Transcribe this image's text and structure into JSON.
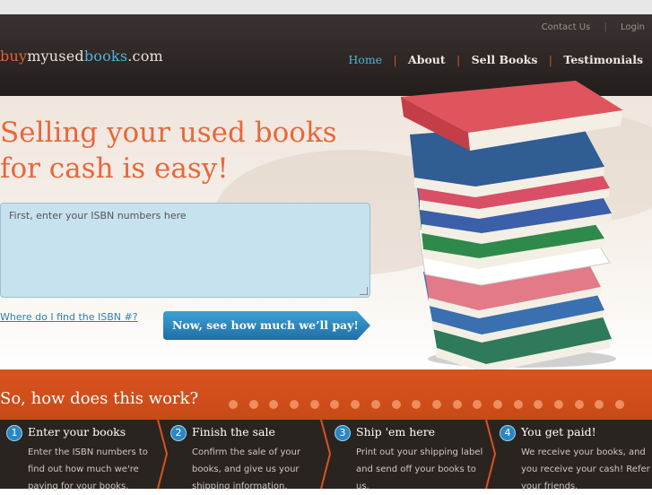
{
  "header": {
    "top_links": {
      "contact": "Contact Us",
      "separator": "|",
      "login": "Login"
    },
    "logo": {
      "part1": "buy",
      "part2": "myused",
      "part3": "books",
      "part4": ".com"
    },
    "nav": [
      {
        "label": "Home",
        "active": true
      },
      {
        "label": "About"
      },
      {
        "label": "Sell Books"
      },
      {
        "label": "Testimonials"
      }
    ],
    "nav_separator": "|"
  },
  "hero": {
    "headline_line1": "Selling your used books",
    "headline_line2": "for cash is easy!",
    "isbn_placeholder": "First, enter your ISBN numbers here",
    "find_isbn_link": "Where do I find the ISBN #?",
    "cta_label": "Now, see how much we’ll pay!"
  },
  "how": {
    "title": "So, how does this work?",
    "steps": [
      {
        "num": "1",
        "title": "Enter your books",
        "desc": "Enter the ISBN numbers to find out how much we're paying for your books."
      },
      {
        "num": "2",
        "title": "Finish the sale",
        "desc": "Confirm the sale of your books, and give us your shipping information."
      },
      {
        "num": "3",
        "title": "Ship 'em here",
        "desc": "Print out your shipping label and send off your books to us."
      },
      {
        "num": "4",
        "title": "You get paid!",
        "desc": "We receive your books, and you receive your cash! Refer your friends."
      }
    ]
  },
  "colors": {
    "accent_orange": "#d9531e",
    "link_blue": "#4fb6d9",
    "header_dark": "#2c2624"
  }
}
